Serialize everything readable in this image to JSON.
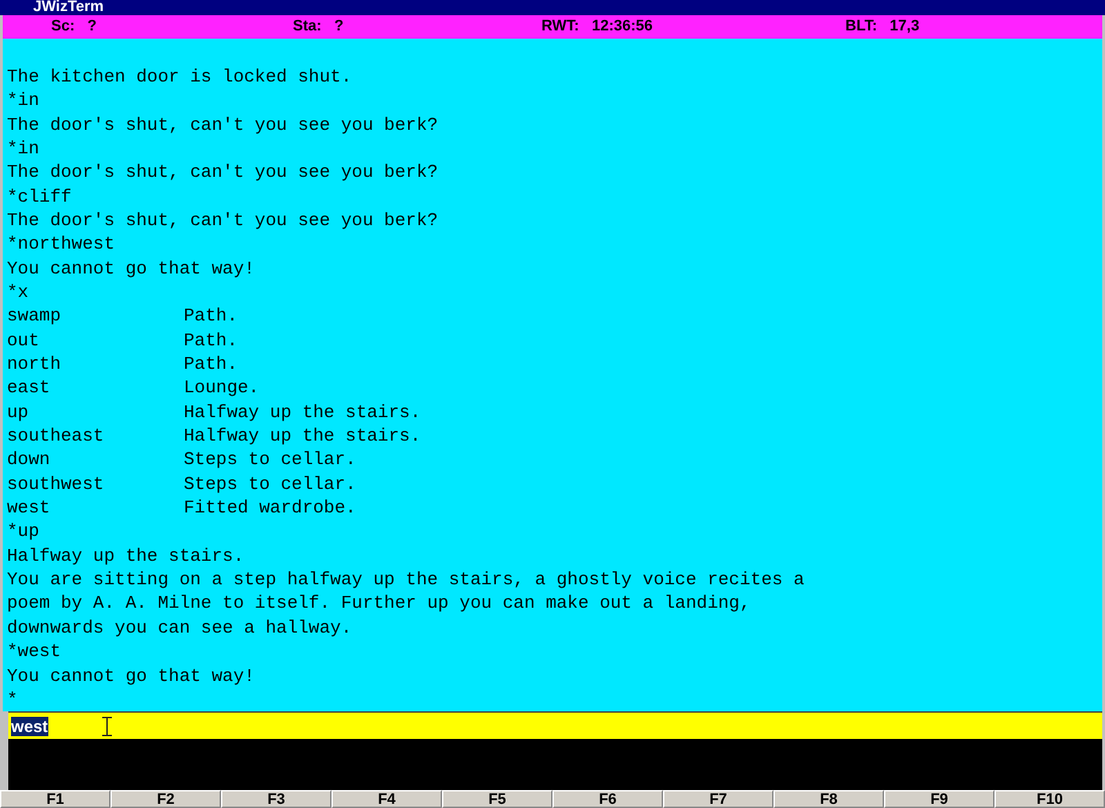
{
  "window": {
    "title": "JWizTerm"
  },
  "status_bar": [
    {
      "label": "Sc:",
      "value": "?"
    },
    {
      "label": "Sta:",
      "value": "?"
    },
    {
      "label": "RWT:",
      "value": "12:36:56"
    },
    {
      "label": "BLT:",
      "value": "17,3"
    }
  ],
  "output": [
    {
      "kind": "text",
      "text": "The kitchen door is locked shut."
    },
    {
      "kind": "text",
      "text": "*in"
    },
    {
      "kind": "text",
      "text": "The door's shut, can't you see you berk?"
    },
    {
      "kind": "text",
      "text": "*in"
    },
    {
      "kind": "text",
      "text": "The door's shut, can't you see you berk?"
    },
    {
      "kind": "text",
      "text": "*cliff"
    },
    {
      "kind": "text",
      "text": "The door's shut, can't you see you berk?"
    },
    {
      "kind": "text",
      "text": "*northwest"
    },
    {
      "kind": "text",
      "text": "You cannot go that way!"
    },
    {
      "kind": "text",
      "text": "*x"
    },
    {
      "kind": "exit",
      "direction": "swamp",
      "destination": "Path."
    },
    {
      "kind": "exit",
      "direction": "out",
      "destination": "Path."
    },
    {
      "kind": "exit",
      "direction": "north",
      "destination": "Path."
    },
    {
      "kind": "exit",
      "direction": "east",
      "destination": "Lounge."
    },
    {
      "kind": "exit",
      "direction": "up",
      "destination": "Halfway up the stairs."
    },
    {
      "kind": "exit",
      "direction": "southeast",
      "destination": "Halfway up the stairs."
    },
    {
      "kind": "exit",
      "direction": "down",
      "destination": "Steps to cellar."
    },
    {
      "kind": "exit",
      "direction": "southwest",
      "destination": "Steps to cellar."
    },
    {
      "kind": "exit",
      "direction": "west",
      "destination": "Fitted wardrobe."
    },
    {
      "kind": "text",
      "text": "*up"
    },
    {
      "kind": "text",
      "text": "Halfway up the stairs."
    },
    {
      "kind": "text",
      "text": "You are sitting on a step halfway up the stairs, a ghostly voice recites a"
    },
    {
      "kind": "text",
      "text": "poem by A. A. Milne to itself. Further up you can make out a landing,"
    },
    {
      "kind": "text",
      "text": "downwards you can see a hallway."
    },
    {
      "kind": "text",
      "text": "*west"
    },
    {
      "kind": "text",
      "text": "You cannot go that way!"
    },
    {
      "kind": "text",
      "text": "*"
    }
  ],
  "command": {
    "value": "west",
    "selected": true
  },
  "function_keys": [
    "F1",
    "F2",
    "F3",
    "F4",
    "F5",
    "F6",
    "F7",
    "F8",
    "F9",
    "F10"
  ]
}
